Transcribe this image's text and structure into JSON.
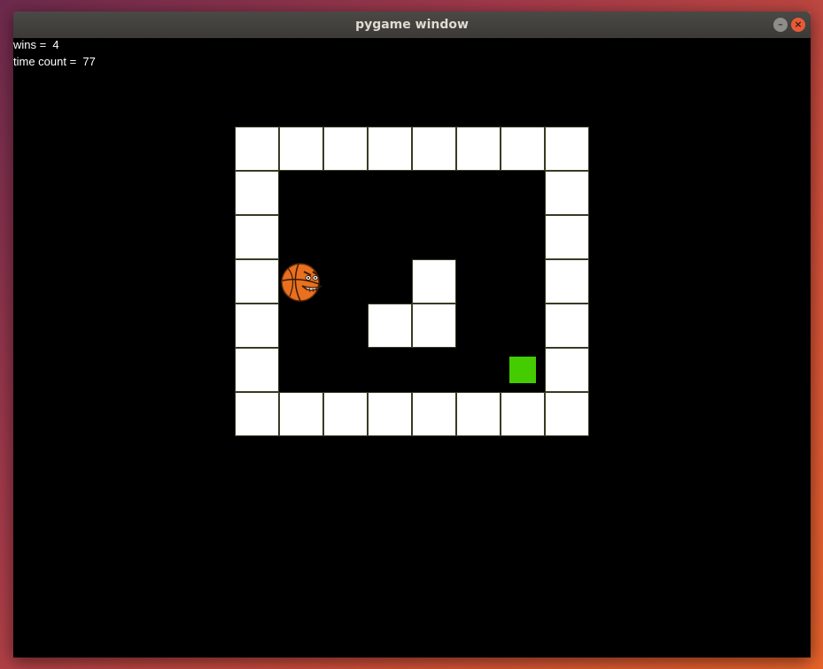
{
  "window": {
    "title": "pygame window",
    "minimize_glyph": "–",
    "close_glyph": "×"
  },
  "hud": {
    "wins_text": "wins =  4",
    "time_text": "time count =  77"
  },
  "colors": {
    "background": "#000000",
    "wall": "#ffffff",
    "goal": "#44cc00",
    "ball": "#e8701f"
  },
  "game": {
    "grid": [
      "########",
      "#......#",
      "#......#",
      "#P..#..#",
      "#..##..#",
      "#.....G#",
      "########"
    ],
    "player_icon": "angry-basketball-icon",
    "goal_icon": "green-square-goal"
  }
}
